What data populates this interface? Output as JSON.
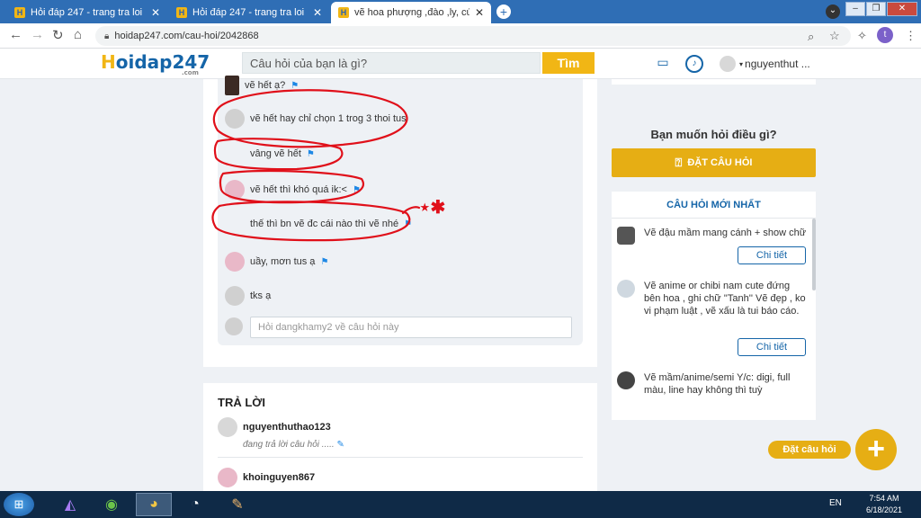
{
  "browser": {
    "tabs": [
      {
        "title": "Hỏi đáp 247 - trang tra loi",
        "active": false
      },
      {
        "title": "Hỏi đáp 247 - trang tra loi",
        "active": false
      },
      {
        "title": "vẽ hoa phượng ,đào ,ly, cúc, bướm",
        "active": true
      }
    ],
    "favicon_letter": "H",
    "url": "hoidap247.com/cau-hoi/2042868",
    "profile_initial": "t"
  },
  "site": {
    "logo_h": "H",
    "logo_rest": "oidap247",
    "logo_com": ".com",
    "search_placeholder": "Câu hỏi của bạn là gì?",
    "search_button": "Tìm",
    "username": "nguyenthut ..."
  },
  "comments": [
    {
      "text": "vẽ hết ạ?",
      "flag": true
    },
    {
      "text": "vẽ hết hay chỉ chọn 1 trog 3 thoi tus",
      "flag": false
    },
    {
      "text": "vâng vẽ hết",
      "flag": true
    },
    {
      "text": "vẽ hết thì khó quá ik:<",
      "flag": true
    },
    {
      "text": "thế thì bn vẽ đc cái nào thì vẽ nhé",
      "flag": true
    },
    {
      "text": "uầy, mơn tus ạ",
      "flag": true
    },
    {
      "text": "tks ạ",
      "flag": false
    }
  ],
  "ask_placeholder": "Hỏi dangkhamy2 về câu hỏi này",
  "answers": {
    "heading": "TRẢ LỜI",
    "users": [
      {
        "name": "nguyenthuthao123",
        "status": "đang trả lời câu hỏi ....."
      },
      {
        "name": "khoinguyen867"
      }
    ]
  },
  "sidebar": {
    "prompt": "Bạn muốn hỏi điều gì?",
    "ask_button": "ĐẶT CÂU HỎI",
    "latest_heading": "CÂU HỎI MỚI NHẤT",
    "questions": [
      {
        "text": "Vẽ đậu mầm mang cánh + show chữ",
        "button": "Chi tiết"
      },
      {
        "text": "Vẽ anime or chibi nam cute đứng bên hoa , ghi chữ ''Tanh'' Vẽ đẹp , ko vi phạm luật , vẽ xấu là tui báo cáo.",
        "button": "Chi tiết"
      },
      {
        "text": "Vẽ mầm/anime/semi Y/c: digi, full màu, line hay không thì tuỳ",
        "button": ""
      }
    ]
  },
  "fab_label": "Đặt câu hỏi",
  "fab_symbol": "+",
  "taskbar": {
    "lang": "EN",
    "time": "7:54 AM",
    "date": "6/18/2021"
  },
  "annotation": "⋆✱",
  "colors": {
    "brand_blue": "#1565a8",
    "brand_yellow": "#f1b615",
    "annotation_red": "#e0101a"
  }
}
